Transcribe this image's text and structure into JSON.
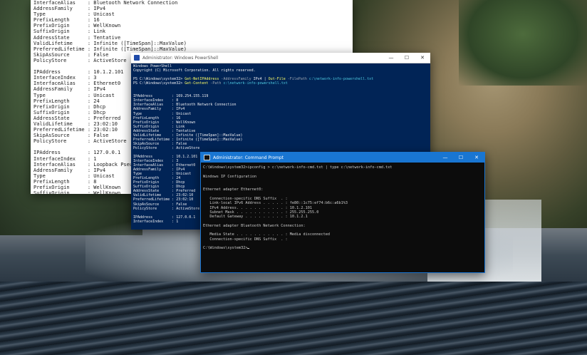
{
  "desktop": {
    "wallpaper": "waterfall-canyon"
  },
  "text_window": {
    "lines": [
      "InterfaceAlias    : Bluetooth Network Connection",
      "AddressFamily     : IPv4",
      "Type              : Unicast",
      "PrefixLength      : 16",
      "PrefixOrigin      : WellKnown",
      "SuffixOrigin      : Link",
      "AddressState      : Tentative",
      "ValidLifetime     : Infinite ([TimeSpan]::MaxValue)",
      "PreferredLifetime : Infinite ([TimeSpan]::MaxValue)",
      "SkipAsSource      : False",
      "PolicyStore       : ActiveStore",
      "",
      "IPAddress         : 10.1.2.101",
      "InterfaceIndex    : 3",
      "InterfaceAlias    : Ethernet0",
      "AddressFamily     : IPv4",
      "Type              : Unicast",
      "PrefixLength      : 24",
      "PrefixOrigin      : Dhcp",
      "SuffixOrigin      : Dhcp",
      "AddressState      : Preferred",
      "ValidLifetime     : 23:02:10",
      "PreferredLifetime : 23:02:10",
      "SkipAsSource      : False",
      "PolicyStore       : ActiveStore",
      "",
      "IPAddress         : 127.0.0.1",
      "InterfaceIndex    : 1",
      "InterfaceAlias    : Loopback Pseudo-Interface 1",
      "AddressFamily     : IPv4",
      "Type              : Unicast",
      "PrefixLength      : 8",
      "PrefixOrigin      : WellKnown",
      "SuffixOrigin      : WellKnown"
    ]
  },
  "powershell": {
    "title": "Administrator: Windows PowerShell",
    "controls": {
      "minimize": "—",
      "maximize": "☐",
      "close": "✕"
    },
    "header_lines": [
      "Windows PowerShell",
      "Copyright (C) Microsoft Corporation. All rights reserved."
    ],
    "cmd1": {
      "prompt": "PS C:\\Windows\\system32> ",
      "cmdlet": "Get-NetIPAddress",
      "param1": " -AddressFamily ",
      "arg1": "IPv4",
      "pipe": " | ",
      "cmdlet2": "Out-File",
      "param2": " -FilePath ",
      "arg2": "c:\\network-info-powershell.txt"
    },
    "cmd2": {
      "prompt": "PS C:\\Windows\\system32> ",
      "cmdlet": "Get-Content",
      "param": " -Path ",
      "arg": "c:\\network-info-powershell.txt"
    },
    "output_lines": [
      "",
      "",
      "IPAddress         : 169.254.155.119",
      "InterfaceIndex    : 8",
      "InterfaceAlias    : Bluetooth Network Connection",
      "AddressFamily     : IPv4",
      "Type              : Unicast",
      "PrefixLength      : 16",
      "PrefixOrigin      : WellKnown",
      "SuffixOrigin      : Link",
      "AddressState      : Tentative",
      "ValidLifetime     : Infinite ([TimeSpan]::MaxValue)",
      "PreferredLifetime : Infinite ([TimeSpan]::MaxValue)",
      "SkipAsSource      : False",
      "PolicyStore       : ActiveStore",
      "",
      "IPAddress         : 10.1.2.101",
      "InterfaceIndex    : 3",
      "InterfaceAlias    : Ethernet0",
      "AddressFamily     : IPv4",
      "Type              : Unicast",
      "PrefixLength      : 24",
      "PrefixOrigin      : Dhcp",
      "SuffixOrigin      : Dhcp",
      "AddressState      : Preferred",
      "ValidLifetime     : 23:02:10",
      "PreferredLifetime : 23:02:10",
      "SkipAsSource      : False",
      "PolicyStore       : ActiveStore",
      "",
      "IPAddress         : 127.0.0.1",
      "InterfaceIndex    : 1"
    ]
  },
  "cmd": {
    "title": "Administrator: Command Prompt",
    "controls": {
      "minimize": "—",
      "maximize": "☐",
      "close": "✕"
    },
    "lines": [
      "C:\\Windows\\system32>ipconfig > c:\\network-info-cmd.txt | type c:\\network-info-cmd.txt",
      "",
      "Windows IP Configuration",
      "",
      "",
      "Ethernet adapter Ethernet0:",
      "",
      "   Connection-specific DNS Suffix  . :",
      "   Link-local IPv6 Address . . . . . : fe80::1c75:ef74:b6c:a6b1%3",
      "   IPv4 Address. . . . . . . . . . . : 10.1.2.101",
      "   Subnet Mask . . . . . . . . . . . : 255.255.255.0",
      "   Default Gateway . . . . . . . . . : 10.1.2.1",
      "",
      "Ethernet adapter Bluetooth Network Connection:",
      "",
      "   Media State . . . . . . . . . . . : Media disconnected",
      "   Connection-specific DNS Suffix  . :",
      ""
    ],
    "prompt": "C:\\Windows\\system32>"
  }
}
